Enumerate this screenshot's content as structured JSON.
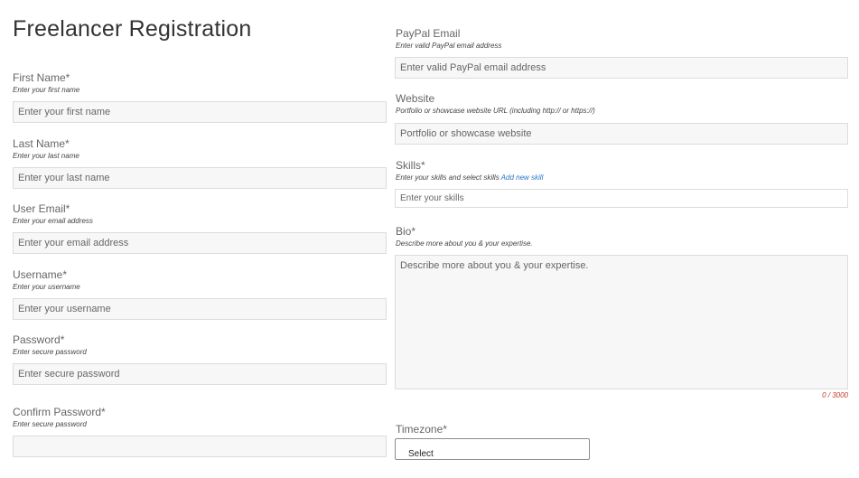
{
  "page": {
    "title": "Freelancer Registration"
  },
  "left_fields": [
    {
      "label": "First Name*",
      "hint": "Enter your first name",
      "placeholder": "Enter your first name"
    },
    {
      "label": "Last Name*",
      "hint": "Enter your last name",
      "placeholder": "Enter your last name"
    },
    {
      "label": "User Email*",
      "hint": "Enter your email address",
      "placeholder": "Enter your email address"
    },
    {
      "label": "Username*",
      "hint": "Enter your username",
      "placeholder": "Enter your username"
    },
    {
      "label": "Password*",
      "hint": "Enter secure password",
      "placeholder": "Enter secure password"
    },
    {
      "label": "Confirm Password*",
      "hint": "Enter secure password",
      "placeholder": ""
    }
  ],
  "paypal": {
    "label": "PayPal Email",
    "hint": "Enter valid PayPal email address",
    "placeholder": "Enter valid PayPal email address"
  },
  "website": {
    "label": "Website",
    "hint": "Portfolio or showcase website URL (including http:// or https://)",
    "placeholder": "Portfolio or showcase website"
  },
  "skills": {
    "label": "Skills*",
    "hint": "Enter your skills and select skills",
    "hint_link": "Add new skill",
    "placeholder": "Enter your skills"
  },
  "bio": {
    "label": "Bio*",
    "hint": "Describe more about you & your expertise.",
    "placeholder": "Describe more about you & your expertise.",
    "counter": "0 / 3000"
  },
  "timezone": {
    "label": "Timezone*",
    "selected": "Select"
  }
}
